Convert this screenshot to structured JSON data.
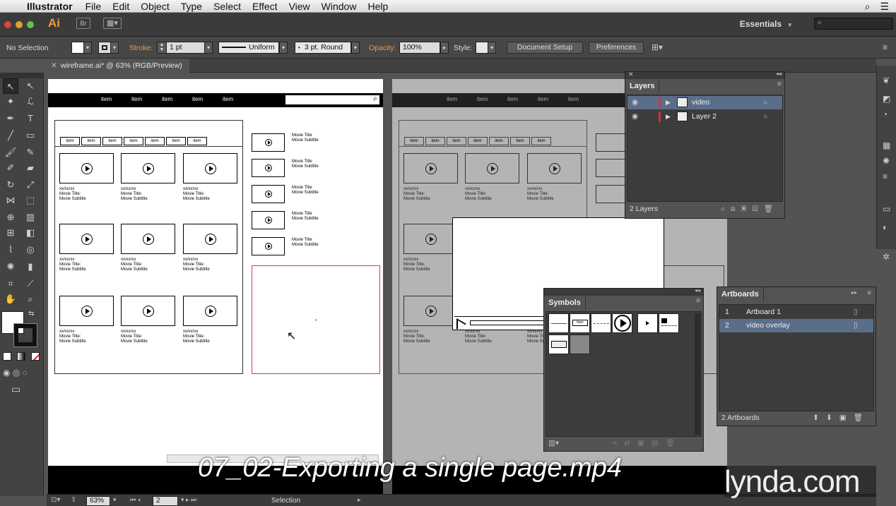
{
  "menubar": {
    "app": "Illustrator",
    "items": [
      "File",
      "Edit",
      "Object",
      "Type",
      "Select",
      "Effect",
      "View",
      "Window",
      "Help"
    ]
  },
  "appbar": {
    "logo": "Ai",
    "bridge": "Br",
    "workspace": "Essentials",
    "workspace_arrow": "▾"
  },
  "control": {
    "selection": "No Selection",
    "stroke_label": "Stroke:",
    "stroke_value": "1 pt",
    "stroke_profile": "Uniform",
    "brush": "3 pt. Round",
    "opacity_label": "Opacity:",
    "opacity_value": "100%",
    "style_label": "Style:",
    "document_setup": "Document Setup",
    "preferences": "Preferences"
  },
  "document": {
    "tab_title": "wireframe.ai* @ 63% (RGB/Preview)"
  },
  "wireframe": {
    "nav_items": [
      "item",
      "item",
      "item",
      "item",
      "item"
    ],
    "tab_items": [
      "item",
      "item",
      "item",
      "item",
      "item",
      "item",
      "item"
    ],
    "video_caption": {
      "date": "xx/xx/xx",
      "title": "Movie Title:",
      "subtitle": "Movie Subtitle"
    },
    "side_caption": {
      "title": "Movie Title",
      "subtitle": "Movie Subtitle"
    }
  },
  "layers": {
    "title": "Layers",
    "rows": [
      {
        "name": "video",
        "selected": true
      },
      {
        "name": "Layer 2",
        "selected": false
      }
    ],
    "footer": "2 Layers"
  },
  "symbols": {
    "title": "Symbols",
    "item_label": "item"
  },
  "artboards": {
    "title": "Artboards",
    "rows": [
      {
        "num": "1",
        "name": "Artboard 1",
        "selected": false
      },
      {
        "num": "2",
        "name": "video overlay",
        "selected": true
      }
    ],
    "footer": "2 Artboards"
  },
  "status": {
    "zoom": "63%",
    "artboard": "2",
    "tool": "Selection"
  },
  "overlay": {
    "title": "07_02-Exporting a single page.mp4",
    "brand": "lynda.com"
  },
  "colors": {
    "accent_orange": "#f39a3a",
    "selection_blue": "#5a6e8a",
    "artboard_red": "#d23a4a",
    "layer_red": "#c8344a"
  }
}
